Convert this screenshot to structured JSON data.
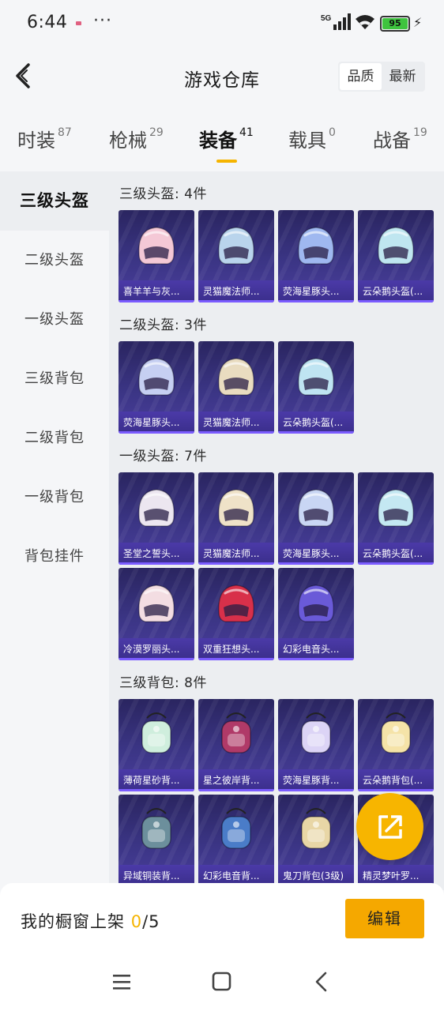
{
  "status_bar": {
    "time": "6:44",
    "more": "···",
    "network": "5G",
    "battery": "95"
  },
  "header": {
    "title": "游戏仓库",
    "sort_options": [
      "品质",
      "最新"
    ],
    "sort_selected": "品质"
  },
  "tabs": [
    {
      "label": "时装",
      "count": "87"
    },
    {
      "label": "枪械",
      "count": "29"
    },
    {
      "label": "装备",
      "count": "41",
      "active": true
    },
    {
      "label": "载具",
      "count": "0"
    },
    {
      "label": "战备",
      "count": "19"
    }
  ],
  "sidebar": [
    {
      "label": "三级头盔",
      "active": true
    },
    {
      "label": "二级头盔"
    },
    {
      "label": "一级头盔"
    },
    {
      "label": "三级背包"
    },
    {
      "label": "二级背包"
    },
    {
      "label": "一级背包"
    },
    {
      "label": "背包挂件"
    }
  ],
  "sections": [
    {
      "title": "三级头盔: 4件",
      "items": [
        {
          "name": "喜羊羊与灰...",
          "icon": "pink-sheep-helmet-icon",
          "color": "#f4c8d6"
        },
        {
          "name": "灵猫魔法师...",
          "icon": "cat-mage-helmet-icon",
          "color": "#b9d4ec"
        },
        {
          "name": "荧海星豚头...",
          "icon": "star-dolphin-helmet-icon",
          "color": "#9fb8f0"
        },
        {
          "name": "云朵鹅头盔(...",
          "icon": "cloud-goose-helmet-icon",
          "color": "#bfe6f0"
        }
      ]
    },
    {
      "title": "二级头盔: 3件",
      "items": [
        {
          "name": "荧海星豚头...",
          "icon": "star-dolphin-helmet-icon",
          "color": "#c6cff2"
        },
        {
          "name": "灵猫魔法师...",
          "icon": "cat-mage-helmet-icon",
          "color": "#e9dcc0"
        },
        {
          "name": "云朵鹅头盔(...",
          "icon": "cloud-goose-helmet-icon",
          "color": "#bfe4f2"
        }
      ]
    },
    {
      "title": "一级头盔: 7件",
      "items": [
        {
          "name": "圣堂之誓头...",
          "icon": "holy-oath-helmet-icon",
          "color": "#ece6f0"
        },
        {
          "name": "灵猫魔法师...",
          "icon": "cat-mage-helmet-icon",
          "color": "#efe2c8"
        },
        {
          "name": "荧海星豚头...",
          "icon": "star-dolphin-helmet-icon",
          "color": "#c9d6f4"
        },
        {
          "name": "云朵鹅头盔(...",
          "icon": "cloud-goose-helmet-icon",
          "color": "#c4e8f2"
        },
        {
          "name": "冷漠罗丽头...",
          "icon": "pink-lolita-helmet-icon",
          "color": "#f3dde2"
        },
        {
          "name": "双重狂想头...",
          "icon": "double-fantasy-helmet-icon",
          "color": "#d8304a"
        },
        {
          "name": "幻彩电音头...",
          "icon": "neon-beat-helmet-icon",
          "color": "#6a5ad8"
        }
      ]
    },
    {
      "title": "三级背包: 8件",
      "items": [
        {
          "name": "薄荷星砂背...",
          "icon": "mint-backpack-icon",
          "color": "#cfeedd"
        },
        {
          "name": "星之彼岸背...",
          "icon": "star-shore-backpack-icon",
          "color": "#b03a68"
        },
        {
          "name": "荧海星豚背...",
          "icon": "star-dolphin-backpack-icon",
          "color": "#dcd4f6"
        },
        {
          "name": "云朵鹅背包(...",
          "icon": "cloud-goose-backpack-icon",
          "color": "#f5e3a8"
        },
        {
          "name": "异域铜装背...",
          "icon": "exotic-backpack-icon",
          "color": "#6c8f9c"
        },
        {
          "name": "幻彩电音背...",
          "icon": "neon-beat-backpack-icon",
          "color": "#4a7cc8"
        },
        {
          "name": "鬼刀背包(3级)",
          "icon": "ghost-blade-backpack-icon",
          "color": "#e8d6a6"
        },
        {
          "name": "精灵梦叶罗...",
          "icon": "elf-dream-backpack-icon",
          "color": "#d4a846"
        }
      ]
    }
  ],
  "footer": {
    "label": "我的橱窗上架",
    "current": "0",
    "total": "/5",
    "edit_button": "编辑"
  },
  "colors": {
    "accent": "#f5b400",
    "card_bg": "#3b3585",
    "card_label": "#4b3aa8"
  }
}
